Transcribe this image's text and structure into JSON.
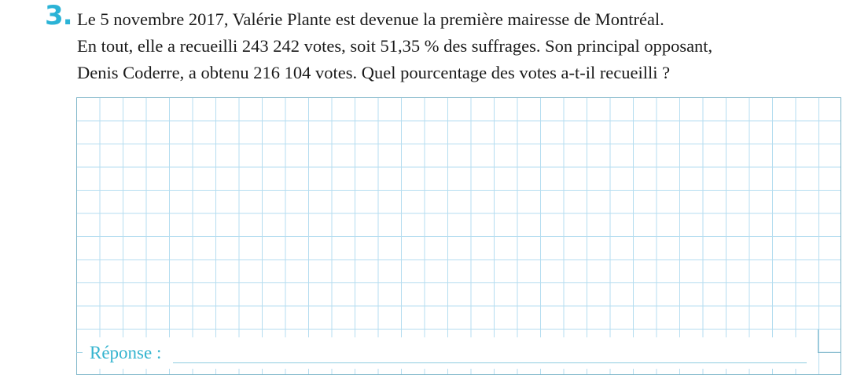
{
  "exercise": {
    "number": "3.",
    "lines": [
      "Le 5 novembre 2017, Valérie Plante est devenue la première mairesse de Montréal.",
      "En tout, elle a recueilli 243 242 votes, soit 51,35 % des suffrages. Son principal opposant,",
      "Denis Coderre, a obtenu 216 104 votes. Quel pourcentage des votes a-t-il recueilli ?"
    ],
    "answer_label": "Réponse :"
  },
  "colors": {
    "accent": "#2bb3d6",
    "grid_line": "#b5ddf0",
    "grid_border": "#7fb6c9",
    "text": "#1a1a1a"
  }
}
